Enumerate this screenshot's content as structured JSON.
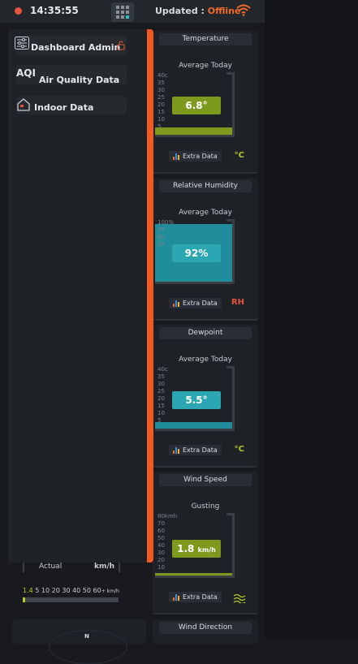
{
  "topbar": {
    "time": "14:35:55",
    "updated_label": "Updated :",
    "status": "Offline"
  },
  "drawer": {
    "items": [
      {
        "label": "Dashboard Admin",
        "icon": "sliders-icon"
      },
      {
        "label": "Air Quality Data",
        "icon_text": "AQI"
      },
      {
        "label": "Indoor Data",
        "icon": "house-icon"
      }
    ]
  },
  "cards": {
    "temperature": {
      "title": "Temperature",
      "subtitle": "Average Today",
      "value": "6.8°",
      "unit": "°C",
      "ticks": [
        "40c",
        "35",
        "30",
        "25",
        "20",
        "15",
        "10",
        "5"
      ],
      "fill_fraction": 0.12,
      "accent": "#7e9a1e"
    },
    "humidity": {
      "title": "Relative Humidity",
      "subtitle": "Average Today",
      "value": "92%",
      "unit": "RH",
      "ticks": [
        "100%",
        "",
        "75",
        "",
        "50",
        "",
        "25"
      ],
      "fill_fraction": 0.92,
      "accent": "#1f8e9a"
    },
    "dewpoint": {
      "title": "Dewpoint",
      "subtitle": "Average Today",
      "value": "5.5°",
      "unit": "°C",
      "ticks": [
        "40c",
        "35",
        "30",
        "25",
        "20",
        "15",
        "10",
        "5"
      ],
      "fill_fraction": 0.1,
      "accent": "#1f8e9a"
    },
    "windspeed": {
      "title": "Wind Speed",
      "subtitle": "Gusting",
      "value": "1.8",
      "value_unit": "km/h",
      "ticks": [
        "80kmh",
        "70",
        "60",
        "50",
        "40",
        "30",
        "20",
        "10"
      ],
      "fill_fraction": 0.02,
      "accent": "#7e9a1e"
    },
    "winddir": {
      "title": "Wind Direction"
    }
  },
  "extra_label": "Extra Data",
  "wind_widget": {
    "actual_label": "Actual",
    "unit_label": "km/h",
    "scale_value": "1.4",
    "scale_text": "5 10 20 30 40 50 60",
    "scale_unit": "+ km/h",
    "fill_fraction": 0.02
  },
  "compass": {
    "north": "N"
  }
}
